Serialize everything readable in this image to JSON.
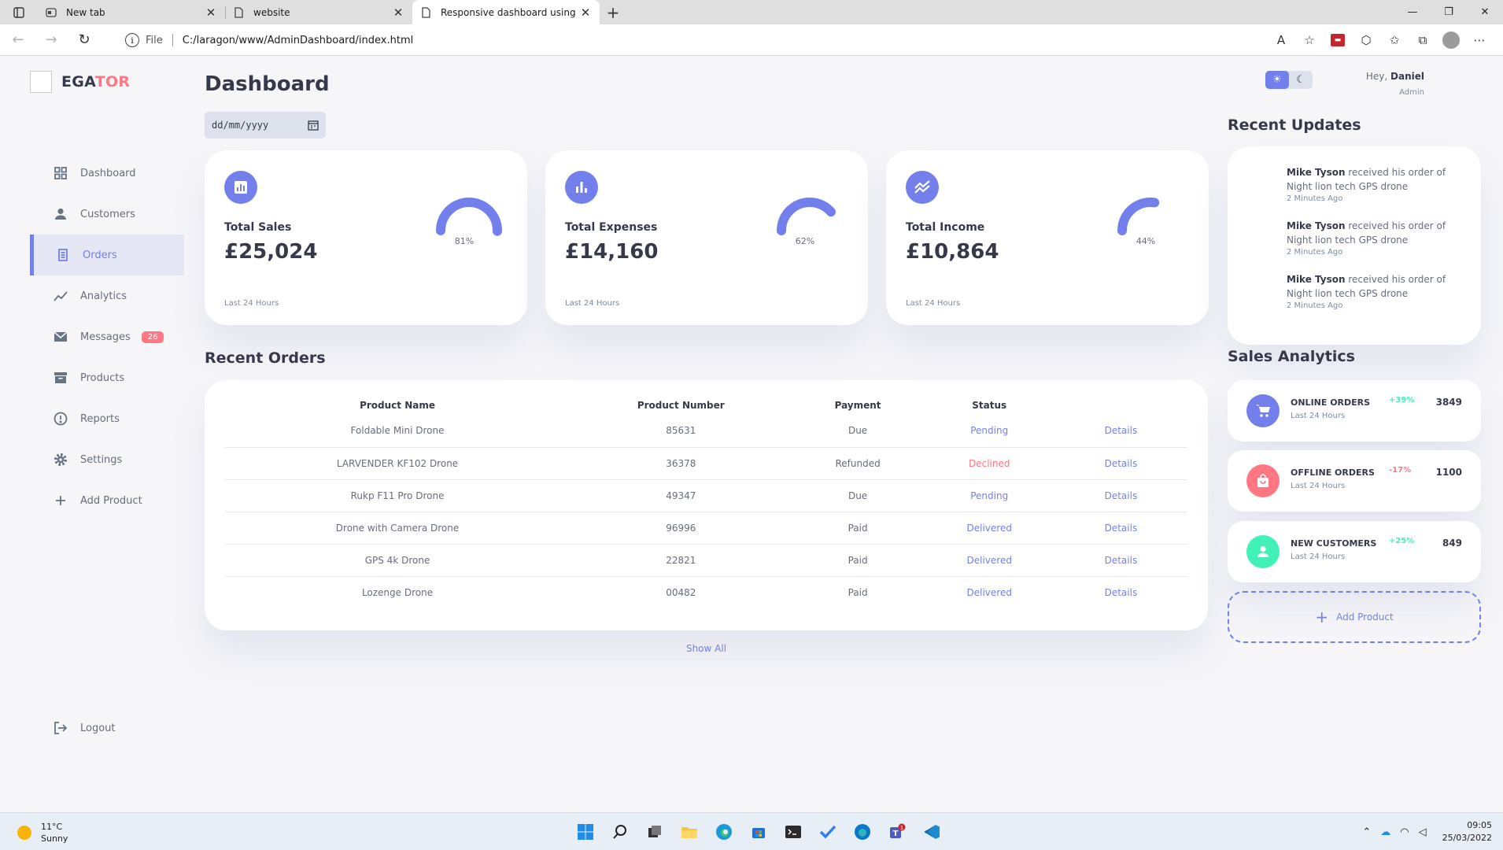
{
  "browser": {
    "tabs": [
      {
        "title": "New tab"
      },
      {
        "title": "website"
      },
      {
        "title": "Responsive dashboard using HTML"
      }
    ],
    "url_scheme": "File",
    "url": "C:/laragon/www/AdminDashboard/index.html"
  },
  "sidebar": {
    "logo_main": "EGA",
    "logo_accent": "TOR",
    "items": [
      {
        "label": "Dashboard",
        "icon": "grid-icon"
      },
      {
        "label": "Customers",
        "icon": "person-icon"
      },
      {
        "label": "Orders",
        "icon": "receipt-icon"
      },
      {
        "label": "Analytics",
        "icon": "insights-icon"
      },
      {
        "label": "Messages",
        "icon": "mail-icon",
        "badge": "26"
      },
      {
        "label": "Products",
        "icon": "inventory-icon"
      },
      {
        "label": "Reports",
        "icon": "report-icon"
      },
      {
        "label": "Settings",
        "icon": "gear-icon"
      },
      {
        "label": "Add Product",
        "icon": "plus-icon"
      }
    ],
    "logout": "Logout"
  },
  "main": {
    "title": "Dashboard",
    "date_placeholder": "dd/mm/yyyy",
    "cards": [
      {
        "heading": "Total Sales",
        "value": "£25,024",
        "percent": "81%",
        "fraction": 0.81,
        "sub": "Last 24 Hours"
      },
      {
        "heading": "Total Expenses",
        "value": "£14,160",
        "percent": "62%",
        "fraction": 0.62,
        "sub": "Last 24 Hours"
      },
      {
        "heading": "Total Income",
        "value": "£10,864",
        "percent": "44%",
        "fraction": 0.44,
        "sub": "Last 24 Hours"
      }
    ],
    "recent_orders_title": "Recent Orders",
    "table": {
      "headers": [
        "Product Name",
        "Product Number",
        "Payment",
        "Status",
        ""
      ],
      "rows": [
        [
          "Foldable Mini Drone",
          "85631",
          "Due",
          "Pending",
          "Details"
        ],
        [
          "LARVENDER KF102 Drone",
          "36378",
          "Refunded",
          "Declined",
          "Details"
        ],
        [
          "Rukp F11 Pro Drone",
          "49347",
          "Due",
          "Pending",
          "Details"
        ],
        [
          "Drone with Camera Drone",
          "96996",
          "Paid",
          "Delivered",
          "Details"
        ],
        [
          "GPS 4k Drone",
          "22821",
          "Paid",
          "Delivered",
          "Details"
        ],
        [
          "Lozenge Drone",
          "00482",
          "Paid",
          "Delivered",
          "Details"
        ]
      ]
    },
    "show_all": "Show All"
  },
  "right": {
    "greeting": "Hey,",
    "user": "Daniel",
    "role": "Admin",
    "recent_updates_title": "Recent Updates",
    "updates": [
      {
        "name": "Mike Tyson",
        "text": "received his order of Night lion tech GPS drone",
        "time": "2 Minutes Ago"
      },
      {
        "name": "Mike Tyson",
        "text": "received his order of Night lion tech GPS drone",
        "time": "2 Minutes Ago"
      },
      {
        "name": "Mike Tyson",
        "text": "received his order of Night lion tech GPS drone",
        "time": "2 Minutes Ago"
      }
    ],
    "sales_analytics_title": "Sales Analytics",
    "analytics": [
      {
        "name": "ONLINE ORDERS",
        "sub": "Last 24 Hours",
        "percent": "+39%",
        "value": "3849",
        "icon": "cart-icon"
      },
      {
        "name": "OFFLINE ORDERS",
        "sub": "Last 24 Hours",
        "percent": "-17%",
        "value": "1100",
        "icon": "bag-icon"
      },
      {
        "name": "NEW CUSTOMERS",
        "sub": "Last 24 Hours",
        "percent": "+25%",
        "value": "849",
        "icon": "person-icon"
      }
    ],
    "add_product": "Add Product"
  },
  "taskbar": {
    "temp": "11°C",
    "condition": "Sunny",
    "time": "09:05",
    "date": "25/03/2022",
    "teams_badge": "1"
  },
  "colors": {
    "primary": "#7380ec",
    "danger": "#ff7782",
    "success": "#41f1b6",
    "background": "#f6f6f9"
  }
}
